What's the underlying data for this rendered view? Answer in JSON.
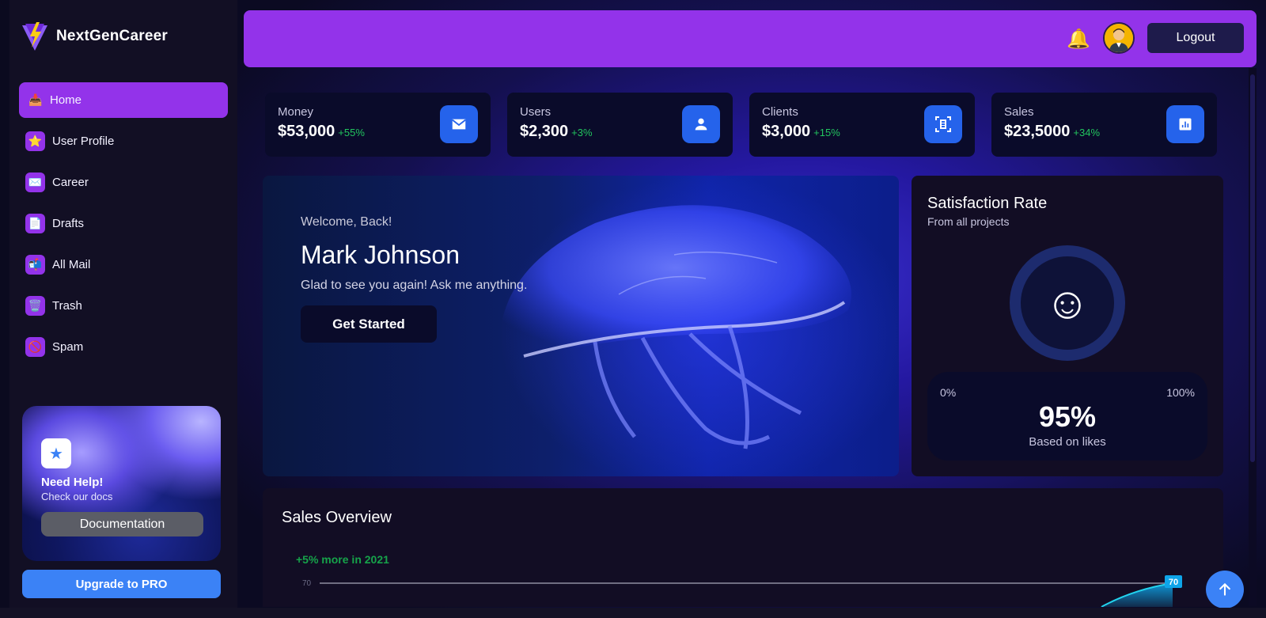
{
  "brand": {
    "name": "NextGenCareer"
  },
  "sidebar": {
    "items": [
      {
        "label": "Home",
        "icon": "inbox-tray-icon",
        "glyph": "📥",
        "active": true
      },
      {
        "label": "User Profile",
        "icon": "star-icon",
        "glyph": "⭐"
      },
      {
        "label": "Career",
        "icon": "envelope-icon",
        "glyph": "✉️"
      },
      {
        "label": "Drafts",
        "icon": "page-icon",
        "glyph": "📄"
      },
      {
        "label": "All Mail",
        "icon": "mailbox-icon",
        "glyph": "📬"
      },
      {
        "label": "Trash",
        "icon": "wastebasket-icon",
        "glyph": "🗑️"
      },
      {
        "label": "Spam",
        "icon": "no-entry-icon",
        "glyph": "🚫"
      }
    ],
    "help": {
      "title": "Need Help!",
      "subtitle": "Check our docs",
      "button": "Documentation"
    },
    "upgrade": "Upgrade to PRO"
  },
  "topbar": {
    "logout": "Logout"
  },
  "stats": [
    {
      "label": "Money",
      "value": "$53,000",
      "change": "+55%",
      "icon": "mail-icon"
    },
    {
      "label": "Users",
      "value": "$2,300",
      "change": "+3%",
      "icon": "user-icon"
    },
    {
      "label": "Clients",
      "value": "$3,000",
      "change": "+15%",
      "icon": "document-scan-icon"
    },
    {
      "label": "Sales",
      "value": "$23,5000",
      "change": "+34%",
      "icon": "bar-chart-icon"
    }
  ],
  "welcome": {
    "greeting": "Welcome, Back!",
    "name": "Mark Johnson",
    "subtitle": "Glad to see you again! Ask me anything.",
    "button": "Get Started"
  },
  "satisfaction": {
    "title": "Satisfaction Rate",
    "subtitle": "From all projects",
    "min": "0%",
    "max": "100%",
    "value": "95%",
    "note": "Based on likes"
  },
  "sales": {
    "title": "Sales Overview",
    "note": "+5% more in 2021"
  },
  "chart_data": {
    "type": "area",
    "title": "",
    "xlabel": "",
    "ylabel": "",
    "ytick_visible": [
      "70"
    ],
    "series": [
      {
        "values": [
          70
        ]
      }
    ],
    "data_labels": [
      "70"
    ],
    "grid": true
  },
  "colors": {
    "accent": "#9333ea",
    "primary": "#3b82f6",
    "positive": "#22c55e",
    "card": "#0a0b2a"
  }
}
